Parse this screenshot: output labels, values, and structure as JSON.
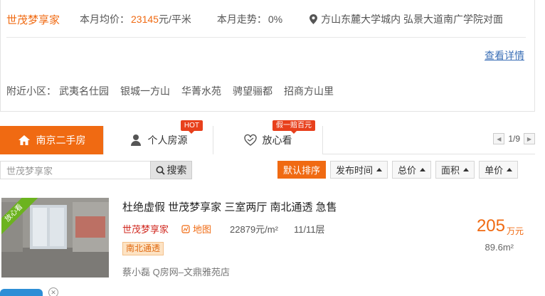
{
  "summary": {
    "community_name": "世茂梦享家",
    "avg_price_label": "本月均价：",
    "avg_price_value": "23145",
    "avg_price_unit": "元/平米",
    "trend_label": "本月走势：",
    "trend_value": "0%",
    "address": "方山东麓大学城内 弘景大道南广学院对面",
    "detail_link": "查看详情",
    "nearby_label": "附近小区：",
    "nearby": [
      "武夷名仕园",
      "银城一方山",
      "华菁水苑",
      "骋望骊都",
      "招商方山里"
    ]
  },
  "tabs": [
    {
      "label": "南京二手房",
      "icon": "house-icon",
      "active": true
    },
    {
      "label": "个人房源",
      "icon": "person-icon",
      "badge": "HOT"
    },
    {
      "label": "放心看",
      "icon": "handshake-icon",
      "badge": "假一赔百元"
    }
  ],
  "pager": {
    "text": "1/9"
  },
  "search": {
    "value": "世茂梦享家",
    "button": "搜索"
  },
  "sort": [
    {
      "label": "默认排序",
      "active": true
    },
    {
      "label": "发布时间"
    },
    {
      "label": "总价"
    },
    {
      "label": "面积"
    },
    {
      "label": "单价"
    }
  ],
  "listing": {
    "ribbon": "放心看",
    "title": "杜绝虚假 世茂梦享家 三室两厅 南北通透 急售",
    "community": "世茂梦享家",
    "map_label": "地图",
    "unit_price": "22879元/m²",
    "floor": "11/11层",
    "tag": "南北通透",
    "agent": "蔡小磊 Q房网–文鼎雅苑店",
    "total_price": "205",
    "total_unit": "万元",
    "area": "89.6m²"
  },
  "colors": {
    "accent": "#f06a12",
    "badge": "#e8401c",
    "link": "#3b6fb6",
    "ribbon": "#6cb31f"
  }
}
